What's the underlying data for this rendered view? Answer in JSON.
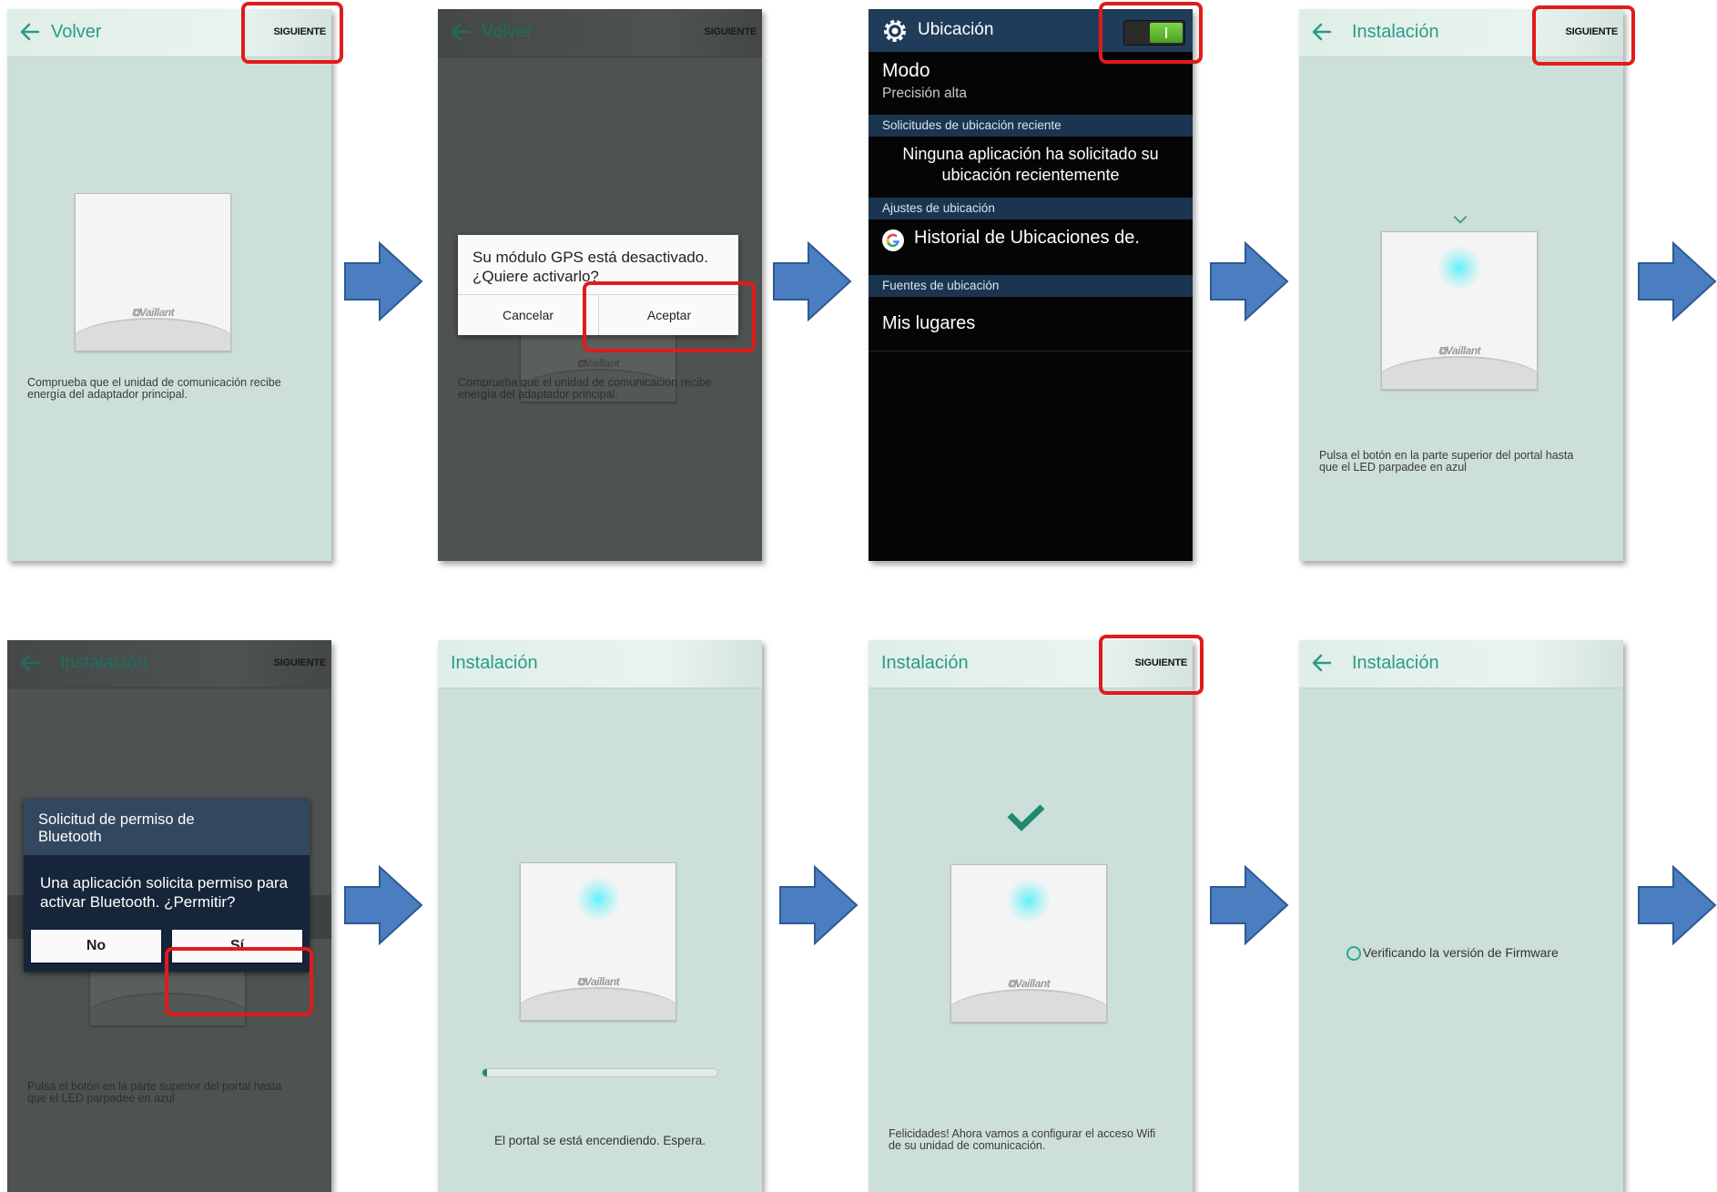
{
  "steps": {
    "s1": {
      "back_label": "Volver",
      "next_label": "SIGUIENTE",
      "brand": "⧉Vaillant",
      "caption": "Comprueba que el unidad de comunicación recibe energía del adaptador principal."
    },
    "s2": {
      "back_label": "Volver",
      "next_label": "SIGUIENTE",
      "brand": "⧉Vaillant",
      "caption": "Comprueba que el unidad de comunicación recibe energía del adaptador principal.",
      "dialog_message": "Su módulo GPS está desactivado. ¿Quiere activarlo?",
      "cancel_label": "Cancelar",
      "accept_label": "Aceptar"
    },
    "s3": {
      "title": "Ubicación",
      "toggle_state": "on",
      "mode_label": "Modo",
      "mode_value": "Precisión alta",
      "section_recent": "Solicitudes de ubicación reciente",
      "recent_empty": "Ninguna aplicación ha solicitado su ubicación recientemente",
      "section_settings": "Ajustes de ubicación",
      "history_label": "Historial de Ubicaciones de.",
      "section_sources": "Fuentes de ubicación",
      "places_label": "Mis lugares"
    },
    "s4": {
      "title": "Instalación",
      "next_label": "SIGUIENTE",
      "brand": "⧉Vaillant",
      "caption": "Pulsa el botón en la parte superior del portal hasta que el LED parpadee en azul"
    },
    "s5": {
      "title": "Instalación",
      "next_label": "SIGUIENTE",
      "brand": "⧉Vaillant",
      "caption": "Pulsa el botón en la parte superior del portal hasta que el LED parpadee en azul",
      "dialog_title": "Solicitud de permiso de Bluetooth",
      "dialog_message": "Una aplicación solicita permiso para activar Bluetooth. ¿Permitir?",
      "no_label": "No",
      "yes_label": "Sí"
    },
    "s6": {
      "title": "Instalación",
      "brand": "⧉Vaillant",
      "progress": 0.02,
      "caption": "El portal se está encendiendo. Espera."
    },
    "s7": {
      "title": "Instalación",
      "next_label": "SIGUIENTE",
      "brand": "⧉Vaillant",
      "caption": "Felicidades! Ahora vamos a configurar el acceso Wifi de su unidad de comunicación."
    },
    "s8": {
      "title": "Instalación",
      "status": "Verificando la versión de Firmware"
    }
  },
  "colors": {
    "highlight": "#e11b1b",
    "arrow": "#4a7ec0",
    "accent": "#2a9b87"
  },
  "icons": [
    "back-arrow-icon",
    "gear-icon",
    "google-icon",
    "check-icon",
    "flow-arrow-icon"
  ]
}
